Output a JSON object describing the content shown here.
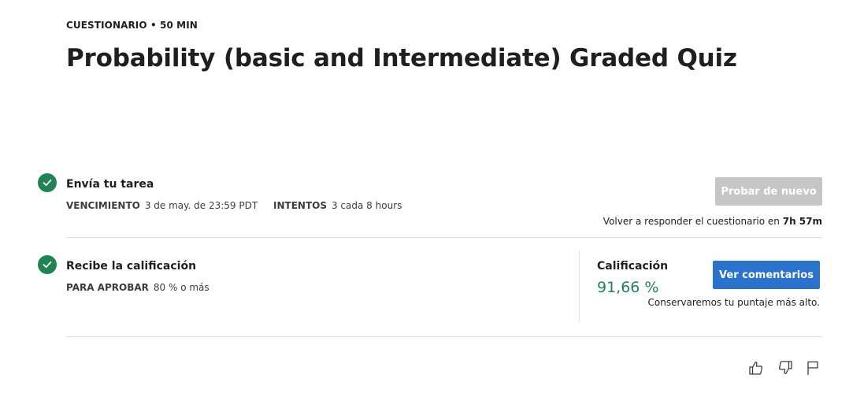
{
  "header": {
    "eyebrow": "CUESTIONARIO • 50 MIN",
    "title": "Probability (basic and Intermediate) Graded Quiz"
  },
  "submit_step": {
    "title": "Envía tu tarea",
    "due_label": "VENCIMIENTO",
    "due_value": "3 de may. de 23:59 PDT",
    "attempts_label": "INTENTOS",
    "attempts_value": "3 cada 8 hours",
    "retry_button": "Probar de nuevo",
    "retry_note_prefix": "Volver a responder el cuestionario en",
    "retry_note_time": "7h 57m"
  },
  "grade_step": {
    "title": "Recibe la calificación",
    "pass_label": "PARA APROBAR",
    "pass_value": "80 % o más",
    "grade_label": "Calificación",
    "grade_value": "91,66 %",
    "feedback_button": "Ver comentarios",
    "keep_note": "Conservaremos tu puntaje más alto."
  },
  "footer_actions": {
    "icons": [
      "thumbs-up-icon",
      "thumbs-down-icon",
      "flag-icon"
    ]
  },
  "colors": {
    "success": "#1f8354",
    "primary": "#2a73cc",
    "disabled": "#c6c6c6"
  }
}
